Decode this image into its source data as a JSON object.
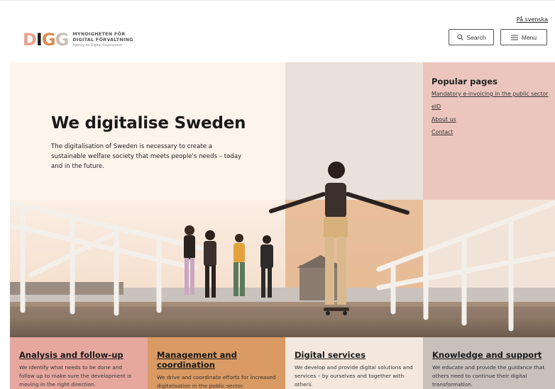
{
  "header": {
    "lang_link": "På svenska",
    "logo_mark": [
      "D",
      "I",
      "G",
      "G"
    ],
    "logo_line1": "MYNDIGHETEN FÖR",
    "logo_line2": "DIGITAL FÖRVALTNING",
    "logo_line3": "Agency for Digital Government",
    "search_label": "Search",
    "menu_label": "Menu"
  },
  "hero": {
    "title": "We digitalise Sweden",
    "description": "The digitalisation of Sweden is necessary to create a sustainable welfare society that meets people's needs – today and in the future."
  },
  "popular": {
    "title": "Popular pages",
    "links": [
      "Mandatory e-invoicing in the public sector",
      "eID",
      "About us",
      "Contact"
    ]
  },
  "cards": [
    {
      "title": "Analysis and follow-up",
      "text": "We identify what needs to be done and follow up to make sure the development is moving in the right direction."
    },
    {
      "title": "Management and coordination",
      "text": "We drive and coordinate efforts for increased digitalisation in the public sector."
    },
    {
      "title": "Digital services",
      "text": "We develop and provide digital solutions and services – by ourselves and together with others."
    },
    {
      "title": "Knowledge and support",
      "text": "We educate and provide the guidance that others need to continue their digital transformation."
    }
  ],
  "colors": {
    "logo_d": "#e8a08f",
    "logo_i": "#1a1a1a",
    "logo_g1": "#d98a4f",
    "logo_g2": "#c8bfb8",
    "card1": "#e6a79f",
    "card2": "#d99a63",
    "card3": "#f4e8de",
    "card4": "#c8c0bb"
  },
  "icons": {
    "search": "search-icon",
    "menu": "hamburger-icon"
  }
}
